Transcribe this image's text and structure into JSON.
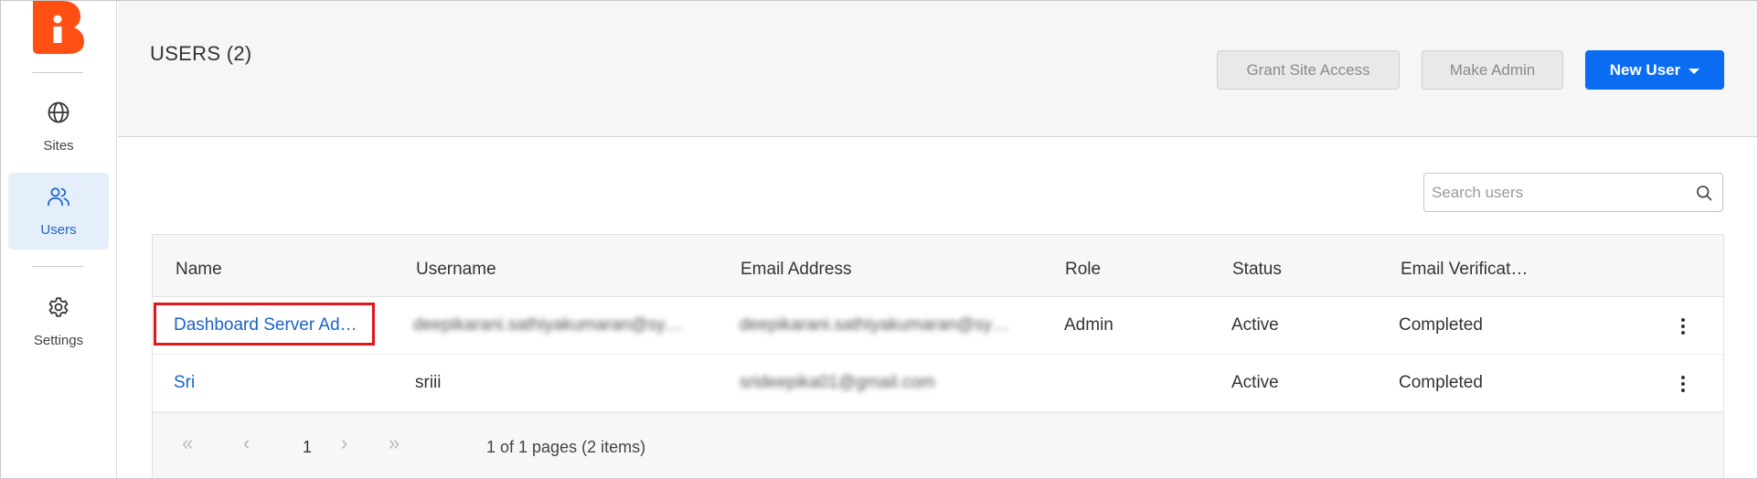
{
  "sidebar": {
    "items": [
      {
        "label": "Sites",
        "icon": "globe-icon",
        "active": false
      },
      {
        "label": "Users",
        "icon": "users-icon",
        "active": true
      },
      {
        "label": "Settings",
        "icon": "gear-icon",
        "active": false
      }
    ]
  },
  "header": {
    "title": "USERS (2)",
    "grant_site_access_label": "Grant Site Access",
    "make_admin_label": "Make Admin",
    "new_user_label": "New User"
  },
  "search": {
    "placeholder": "Search users"
  },
  "table": {
    "columns": [
      "Name",
      "Username",
      "Email Address",
      "Role",
      "Status",
      "Email Verificat…"
    ],
    "rows": [
      {
        "name": "Dashboard Server Ad…",
        "username": "deepikarani.sathiyakumaran@sy…",
        "email": "deepikarani.sathiyakumaran@sy…",
        "role": "Admin",
        "status": "Active",
        "verification": "Completed"
      },
      {
        "name": "Sri",
        "username": "sriii",
        "email": "srideepika01@gmail.com",
        "role": "",
        "status": "Active",
        "verification": "Completed"
      }
    ]
  },
  "pager": {
    "first": "«",
    "prev": "‹",
    "page": "1",
    "next": "›",
    "last": "»",
    "info": "1 of 1 pages (2 items)"
  },
  "colors": {
    "accent": "#0a6cf2",
    "brand": "#ff4f12",
    "active_nav_bg": "#e5effb",
    "highlight": "#e0161b"
  }
}
